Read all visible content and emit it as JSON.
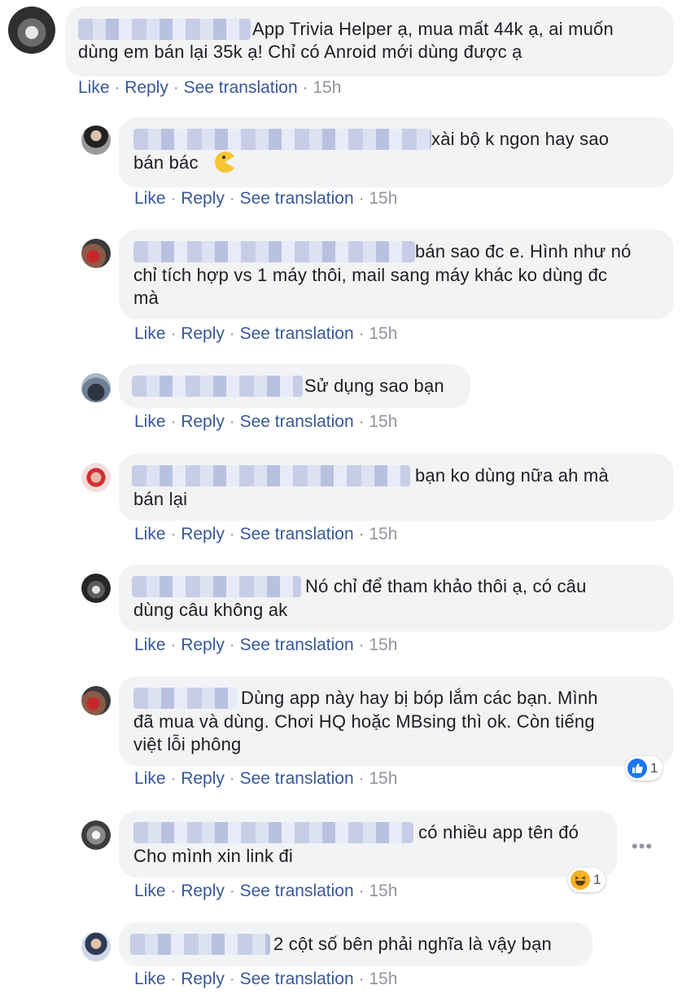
{
  "comments": [
    {
      "text1": "App Trivia Helper ạ, mua mất 44k ạ, ai muốn",
      "text2": "dùng em bán lại 35k ạ! Chỉ có Anroid mới dùng được ạ",
      "like": "Like",
      "reply": "Reply",
      "see_translation": "See translation",
      "time": "15h"
    },
    {
      "text1": "xài bộ k ngon hay sao",
      "text2": "bán bác",
      "like": "Like",
      "reply": "Reply",
      "see_translation": "See translation",
      "time": "15h"
    },
    {
      "text1": "bán sao đc e. Hình như nó",
      "text2": "chỉ tích hợp vs 1 máy thôi, mail sang máy khác ko dùng đc",
      "text3": "mà",
      "like": "Like",
      "reply": "Reply",
      "see_translation": "See translation",
      "time": "15h"
    },
    {
      "text1": "Sử dụng sao bạn",
      "like": "Like",
      "reply": "Reply",
      "see_translation": "See translation",
      "time": "15h"
    },
    {
      "text1": "bạn ko dùng nữa ah mà",
      "text2": "bán lại",
      "like": "Like",
      "reply": "Reply",
      "see_translation": "See translation",
      "time": "15h"
    },
    {
      "text1": "Nó chỉ để tham khảo thôi ạ, có câu",
      "text2": "dùng câu không ak",
      "like": "Like",
      "reply": "Reply",
      "see_translation": "See translation",
      "time": "15h"
    },
    {
      "text1": "Dùng app này hay bị bóp lắm các bạn. Mình",
      "text2": "đã mua và dùng. Chơi HQ hoặc MBsing thì ok. Còn tiếng",
      "text3": "việt lỗi phông",
      "like": "Like",
      "reply": "Reply",
      "see_translation": "See translation",
      "time": "15h",
      "reaction": {
        "icon": "like-reaction-icon",
        "count": "1",
        "color": "#1877f2"
      }
    },
    {
      "text1": "có nhiều app tên đó",
      "text2": "Cho mình xin link đi",
      "like": "Like",
      "reply": "Reply",
      "see_translation": "See translation",
      "time": "15h",
      "reaction": {
        "icon": "haha-reaction-icon",
        "count": "1",
        "color": "#f7b125"
      },
      "more": "•••"
    },
    {
      "text1": "2 cột số bên phải nghĩa là vậy bạn",
      "like": "Like",
      "reply": "Reply",
      "see_translation": "See translation",
      "time": "15h"
    }
  ],
  "colors": {
    "bubble": "#f2f3f5",
    "link": "#385898",
    "meta": "#90949c",
    "text": "#1c1e21"
  },
  "icons": {
    "emoji_in_comment_2": "pacman-emoji-icon"
  }
}
